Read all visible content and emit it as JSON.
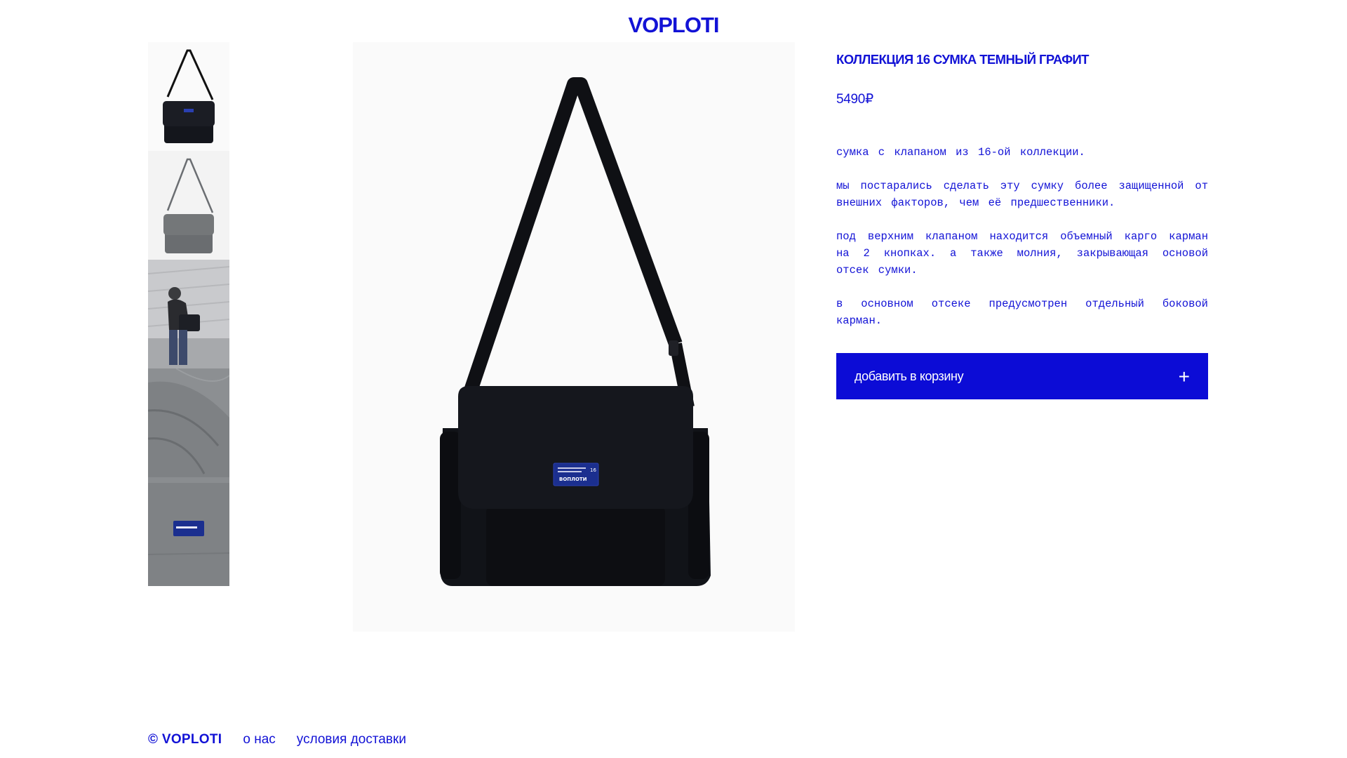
{
  "header": {
    "logo": "VOPLOTI"
  },
  "product": {
    "title": "КОЛЛЕКЦИЯ 16 СУМКА ТЕМНЫЙ ГРАФИТ",
    "price": "5490₽",
    "description": [
      "сумка с клапаном из 16-ой коллекции.",
      "мы постарались сделать эту сумку более защищенной от внешних факторов, чем её предшественники.",
      "под верхним клапаном находится объемный карго карман на 2 кнопках. а также молния, закрывающая основой отсек сумки.",
      "в основном отсеке предусмотрен отдельный боковой карман."
    ],
    "patch_label": "ВОПЛОТИ",
    "patch_number": "16"
  },
  "cart_button": {
    "label": "добавить в корзину",
    "icon": "+"
  },
  "footer": {
    "copyright": "© VOPLOTI",
    "links": [
      "о нас",
      "условия доставки"
    ]
  },
  "colors": {
    "accent": "#1212d6",
    "button_bg": "#0c0cd6",
    "bag": "#14161c",
    "patch": "#1b2f8f"
  }
}
